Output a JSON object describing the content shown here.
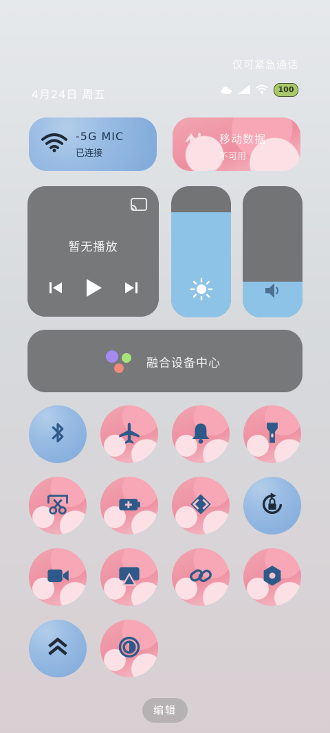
{
  "status": {
    "emergency_text": "仅可紧急通话",
    "date": "4月24日 周五",
    "battery": "100"
  },
  "tiles": {
    "wifi": {
      "title": "-5G     MIC",
      "subtitle": "已连接"
    },
    "mobile": {
      "title": "移动数据",
      "subtitle": "不可用"
    }
  },
  "media": {
    "title": "暂无播放"
  },
  "sliders": {
    "brightness": 0.8,
    "volume": 0.27
  },
  "device_center": {
    "label": "融合设备中心"
  },
  "toggles": [
    {
      "icon": "bluetooth-icon",
      "style": "blue"
    },
    {
      "icon": "airplane-icon",
      "style": "pink"
    },
    {
      "icon": "bell-icon",
      "style": "pink"
    },
    {
      "icon": "flashlight-icon",
      "style": "pink"
    },
    {
      "icon": "screenshot-icon",
      "style": "pink"
    },
    {
      "icon": "battery-saver-icon",
      "style": "pink"
    },
    {
      "icon": "nearby-share-icon",
      "style": "pink"
    },
    {
      "icon": "rotation-lock-icon",
      "style": "blue"
    },
    {
      "icon": "screen-record-icon",
      "style": "pink"
    },
    {
      "icon": "screen-cast-icon",
      "style": "pink"
    },
    {
      "icon": "link-icon",
      "style": "pink"
    },
    {
      "icon": "hotspot-icon",
      "style": "pink"
    },
    {
      "icon": "performance-mode-icon",
      "style": "blue"
    },
    {
      "icon": "dark-mode-icon",
      "style": "pink"
    }
  ],
  "edit": {
    "label": "编辑"
  },
  "colors": {
    "blue_tile": "#98bbe3",
    "pink_tile": "#ee8fa0",
    "icon": "#2e5a8a",
    "panel": "#767879",
    "slider_fill": "#8ec3e8"
  }
}
